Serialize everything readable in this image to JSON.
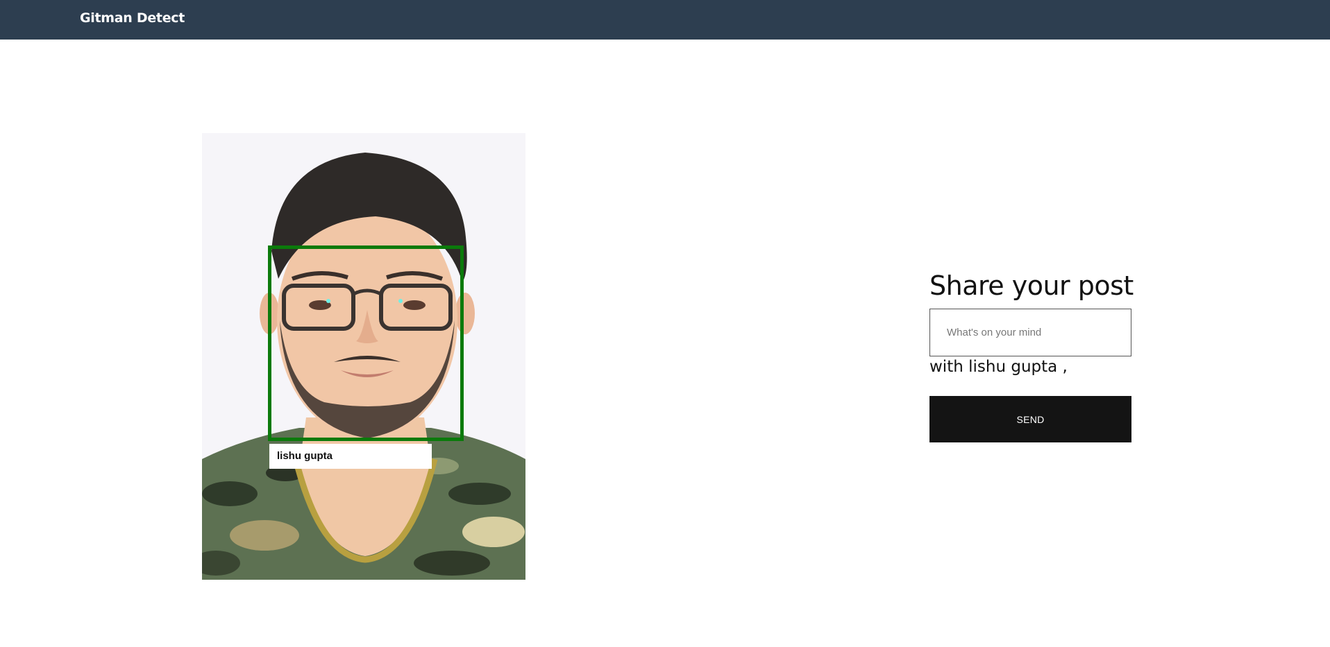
{
  "navbar": {
    "brand": "Gitman Detect"
  },
  "photo": {
    "subject": "person-portrait",
    "detection_label": "lishu gupta",
    "box_color": "#0b7a0b"
  },
  "share": {
    "title": "Share your post",
    "input_placeholder": "What's on your mind",
    "with_prefix": "with",
    "user_name": "lishu gupta ,",
    "send_label": "SEND"
  },
  "colors": {
    "navbar": "#2d3e50",
    "button": "#141414"
  }
}
